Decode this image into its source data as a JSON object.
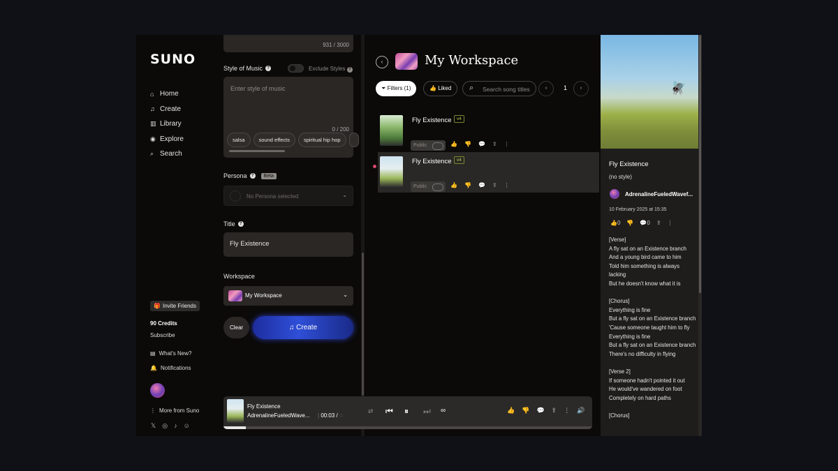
{
  "sidebar": {
    "logo": "SUNO",
    "nav": [
      {
        "label": "Home",
        "icon": "home-icon",
        "glyph": "⌂"
      },
      {
        "label": "Create",
        "icon": "music-note-icon",
        "glyph": "♫"
      },
      {
        "label": "Library",
        "icon": "library-icon",
        "glyph": "▥"
      },
      {
        "label": "Explore",
        "icon": "compass-icon",
        "glyph": "◉"
      },
      {
        "label": "Search",
        "icon": "search-icon",
        "glyph": "⌕"
      }
    ],
    "invite_label": "Invite Friends",
    "credits": "90 Credits",
    "subscribe": "Subscribe",
    "whats_new": "What's New?",
    "notifications": "Notifications",
    "more_from": "More from Suno"
  },
  "create_panel": {
    "lyrics_count": "931 / 3000",
    "style_label": "Style of Music",
    "exclude_styles": "Exclude Styles",
    "style_placeholder": "Enter style of music",
    "style_count": "0 / 200",
    "style_chips": [
      "salsa",
      "sound effects",
      "spiritual hip hop",
      ""
    ],
    "persona_label": "Persona",
    "persona_badge": "Beta",
    "persona_placeholder": "No Persona selected",
    "title_label": "Title",
    "title_value": "Fly Existence",
    "workspace_label": "Workspace",
    "workspace_value": "My Workspace",
    "clear_label": "Clear",
    "create_label": "Create"
  },
  "workspace": {
    "title": "My Workspace",
    "filters_label": "Filters (1)",
    "liked_label": "Liked",
    "search_placeholder": "Search song titles",
    "page": "1",
    "songs": [
      {
        "title": "Fly Existence",
        "version": "v4",
        "visibility": "Public"
      },
      {
        "title": "Fly Existence",
        "version": "v4",
        "visibility": "Public"
      }
    ]
  },
  "detail": {
    "title": "Fly Existence",
    "style": "(no style)",
    "author": "AdrenalineFueledWavef...",
    "date": "10 February 2025 at 15:35",
    "likes": "0",
    "comments": "0",
    "lyrics": "[Verse]\nA fly sat on an Existence branch\nAnd a young bird came to him\nTold him something is always lacking\nBut he doesn't know what it is\n\n[Chorus]\nEverything is fine\nBut a fly sat on an Existence branch\n'Cause someone taught him to fly\nEverything is fine\nBut a fly sat on an Existence branch\nThere's no difficulty in flying\n\n[Verse 2]\nIf someone hadn't pointed it out\nHe would've wandered on foot\nCompletely on hard paths\n\n[Chorus]"
  },
  "player": {
    "title": "Fly Existence",
    "author": "AdrenalineFueledWave...",
    "time": "00:03 /",
    "progress": 0.06
  }
}
